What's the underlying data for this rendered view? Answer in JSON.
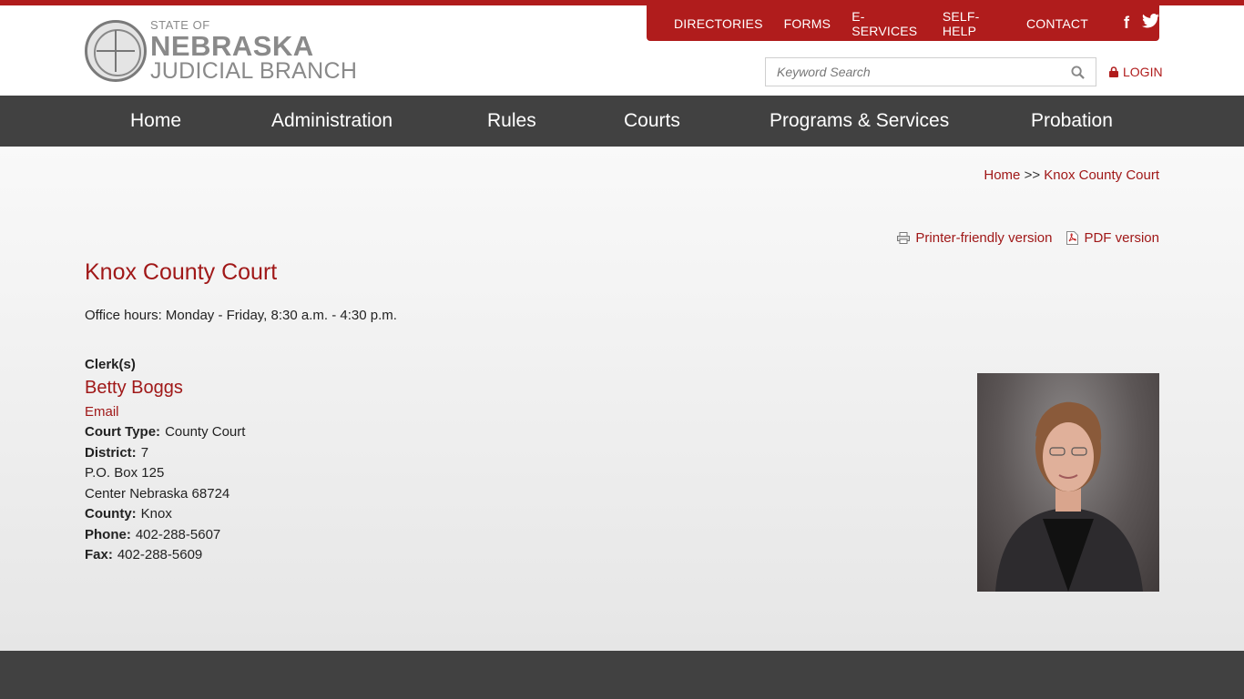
{
  "header": {
    "logo": {
      "state": "STATE OF",
      "name": "NEBRASKA",
      "branch": "JUDICIAL BRANCH"
    },
    "utility_links": [
      "DIRECTORIES",
      "FORMS",
      "E-SERVICES",
      "SELF-HELP",
      "CONTACT"
    ],
    "social": {
      "facebook": "f",
      "twitter": "twitter-icon"
    },
    "search": {
      "placeholder": "Keyword Search"
    },
    "login_label": "LOGIN"
  },
  "nav": {
    "items": [
      "Home",
      "Administration",
      "Rules",
      "Courts",
      "Programs & Services",
      "Probation"
    ]
  },
  "breadcrumb": {
    "home": "Home",
    "separator": ">>",
    "current": "Knox County Court"
  },
  "tools": {
    "printer": "Printer-friendly version",
    "pdf": "PDF version"
  },
  "page": {
    "title": "Knox County Court",
    "hours": "Office hours: Monday - Friday, 8:30 a.m. - 4:30 p.m.",
    "clerk_heading": "Clerk(s)",
    "clerk_name": "Betty Boggs",
    "email_label": "Email",
    "court_type_label": "Court Type:",
    "court_type": "County Court",
    "district_label": "District:",
    "district": "7",
    "address_line1": "P.O. Box 125",
    "address_line2": "Center Nebraska 68724",
    "county_label": "County:",
    "county": "Knox",
    "phone_label": "Phone:",
    "phone": "402-288-5607",
    "fax_label": "Fax:",
    "fax": "402-288-5609"
  },
  "colors": {
    "brand_red": "#b01c1c",
    "nav_gray": "#414141",
    "link_red": "#a01818"
  }
}
